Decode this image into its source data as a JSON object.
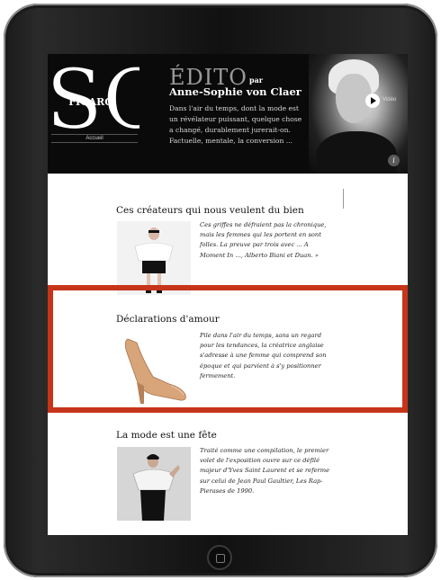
{
  "header": {
    "logo_so": "SO",
    "logo_figaro": "FIGARO",
    "nav_home": "Accueil",
    "edito_title": "ÉDITO",
    "edito_par": "par",
    "author": "Anne-Sophie von Claer",
    "intro": "Dans l'air du temps, dont la mode est un révélateur puissant, quelque chose a changé, durablement jurerait-on. Factuelle, mentale, la conversion ...",
    "video_label": "Vidéo",
    "info_label": "i"
  },
  "articles": [
    {
      "title": "Ces créateurs qui nous veulent du bien",
      "text": "Ces griffes ne défraient pas la chronique, mais les femmes qui les portent en sont folles. La preuve par trois avec ... A Moment In ..., Alberto Biani et Duan. »"
    },
    {
      "title": "Déclarations d'amour",
      "text": "Pile dans l'air du temps, sans un regard pour les tendances, la créatrice anglaise s'adresse à une femme qui comprend son époque et qui parvient à s'y positionner fermement."
    },
    {
      "title": "La mode est une fête",
      "text": "Traité comme une compilation, le premier volet de l'exposition ouvre sur ce défilé majeur d'Yves Saint Laurent et se referme sur celui de Jean Paul Gaultier, Les Rap-Pierases de 1990."
    }
  ],
  "colors": {
    "highlight": "#c6341a",
    "header_bg": "#0a0a0a"
  }
}
